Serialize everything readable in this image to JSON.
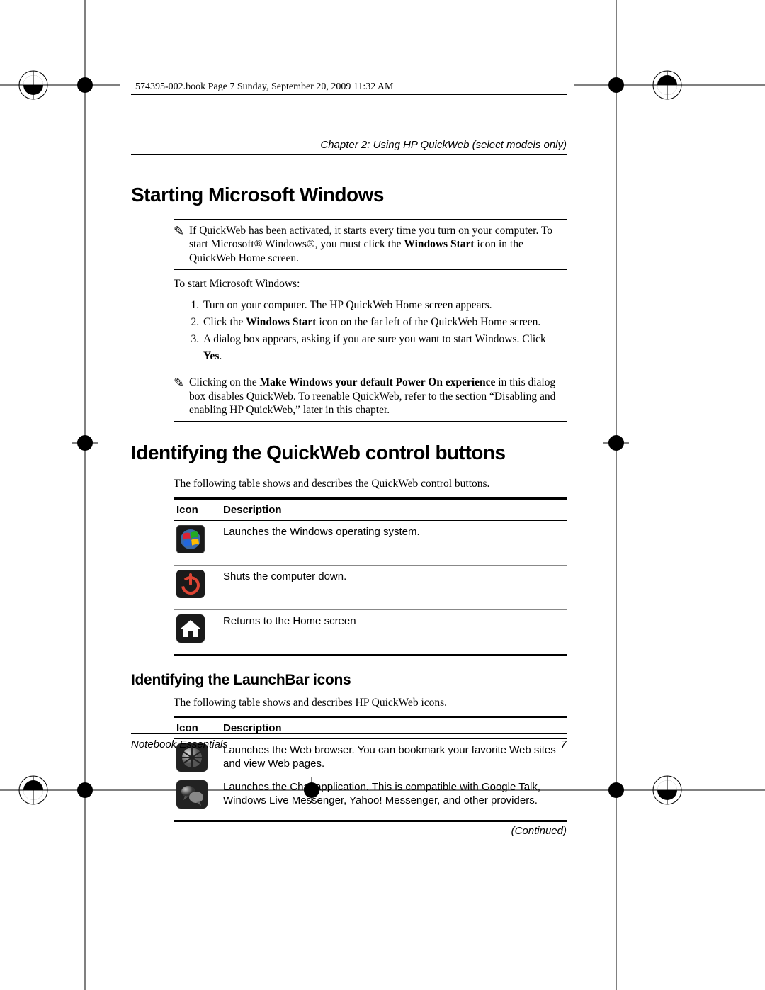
{
  "book_header": "574395-002.book  Page 7  Sunday, September 20, 2009  11:32 AM",
  "chapter_line": "Chapter 2: Using HP QuickWeb (select models only)",
  "section1": {
    "title": "Starting Microsoft Windows",
    "note1_pre": "If QuickWeb has been activated, it starts every time you turn on your computer. To start Microsoft® Windows®, you must click the ",
    "note1_bold": "Windows Start",
    "note1_post": " icon in the QuickWeb Home screen.",
    "lead": "To start Microsoft Windows:",
    "steps": {
      "s1": "Turn on your computer. The HP QuickWeb Home screen appears.",
      "s2_pre": "Click the ",
      "s2_bold": "Windows Start",
      "s2_post": " icon on the far left of the QuickWeb Home screen.",
      "s3_pre": "A dialog box appears, asking if you are sure you want to start Windows. Click ",
      "s3_bold": "Yes",
      "s3_post": "."
    },
    "note2_pre": "Clicking on the ",
    "note2_bold": "Make Windows your default Power On experience",
    "note2_post": " in this dialog box disables QuickWeb. To reenable QuickWeb, refer to the section “Disabling and enabling HP QuickWeb,” later in this chapter."
  },
  "section2": {
    "title": "Identifying the QuickWeb control buttons",
    "lead": "The following table shows and describes the QuickWeb control buttons.",
    "th_icon": "Icon",
    "th_desc": "Description",
    "rows": {
      "r1": "Launches the Windows operating system.",
      "r2": "Shuts the computer down.",
      "r3": "Returns to the Home screen"
    }
  },
  "section3": {
    "title": "Identifying the LaunchBar icons",
    "lead": "The following table shows and describes HP QuickWeb icons.",
    "th_icon": "Icon",
    "th_desc": "Description",
    "rows": {
      "r1": "Launches the Web browser. You can bookmark your favorite Web sites and view Web pages.",
      "r2": "Launches the Chat application. This is compatible with Google Talk, Windows Live Messenger, Yahoo! Messenger, and other providers."
    },
    "continued": "(Continued)"
  },
  "footer": {
    "left": "Notebook Essentials",
    "right": "7"
  }
}
